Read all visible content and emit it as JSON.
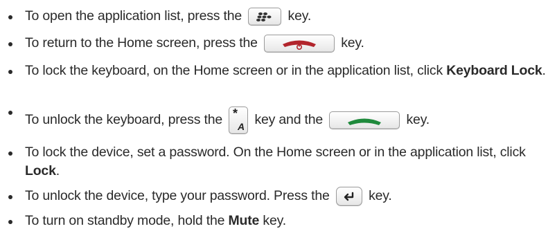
{
  "items": [
    {
      "parts": [
        "To open the application list, press the",
        "key."
      ],
      "key_icon": "blackberry-menu-key-icon"
    },
    {
      "parts": [
        "To return to the Home screen, press the",
        "key."
      ],
      "key_icon": "end-power-key-icon",
      "key_color": "#b2252c"
    },
    {
      "text": "To lock the keyboard, on the Home screen or in the application list, click",
      "bold": "Keyboard Lock",
      "end": "."
    },
    {
      "parts": [
        "To unlock the keyboard, press the",
        "key and the",
        "key."
      ],
      "key_icons": [
        "asterisk-alt-key-icon",
        "send-call-key-icon"
      ],
      "key_color": "#1f8a3c"
    },
    {
      "text": "To lock the device, set a password. On the Home screen or in the application list, click",
      "bold": "Lock",
      "end": "."
    },
    {
      "parts": [
        "To unlock the device, type your password. Press the",
        "key."
      ],
      "key_icon": "enter-key-icon"
    },
    {
      "text": "To turn on standby mode, hold the",
      "bold": "Mute",
      "end": "key."
    }
  ],
  "alt_key_glyphs": {
    "top": "*",
    "bottom": "A"
  }
}
